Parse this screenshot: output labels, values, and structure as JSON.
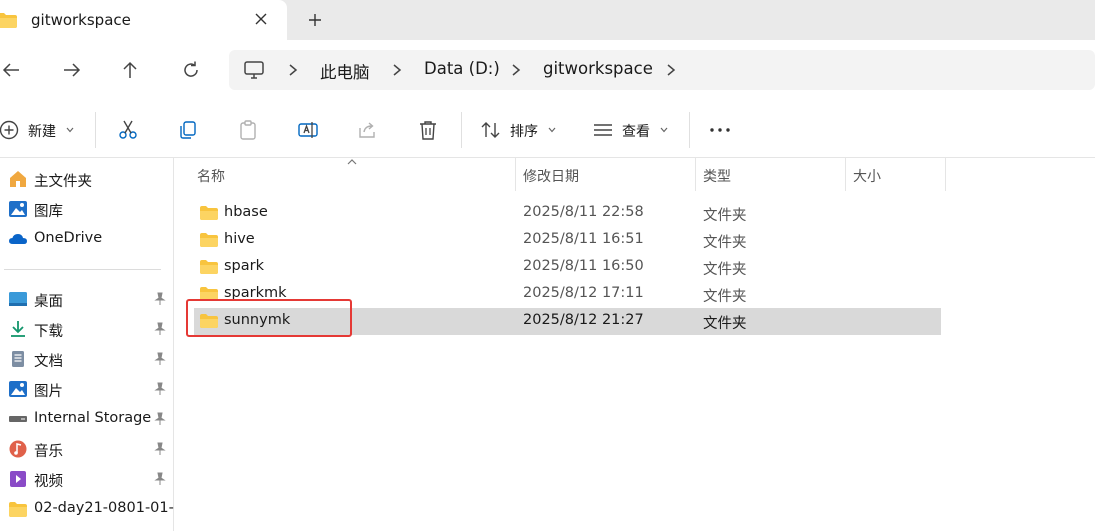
{
  "tab": {
    "title": "gitworkspace"
  },
  "address": {
    "crumbs": [
      "此电脑",
      "Data (D:)",
      "gitworkspace"
    ]
  },
  "toolbar": {
    "new_label": "新建",
    "sort_label": "排序",
    "view_label": "查看"
  },
  "sidebar": {
    "top": [
      {
        "label": "主文件夹",
        "icon": "home-icon"
      },
      {
        "label": "图库",
        "icon": "gallery-icon"
      },
      {
        "label": "OneDrive",
        "icon": "cloud-icon"
      }
    ],
    "pinned": [
      {
        "label": "桌面",
        "icon": "desktop-icon"
      },
      {
        "label": "下载",
        "icon": "download-icon"
      },
      {
        "label": "文档",
        "icon": "document-icon"
      },
      {
        "label": "图片",
        "icon": "pictures-icon"
      },
      {
        "label": "Internal Storage",
        "icon": "drive-icon"
      },
      {
        "label": "音乐",
        "icon": "music-icon"
      },
      {
        "label": "视频",
        "icon": "video-icon"
      },
      {
        "label": "02-day21-0801-01-",
        "icon": "folder-icon"
      }
    ]
  },
  "columns": {
    "name": "名称",
    "modified": "修改日期",
    "type": "类型",
    "size": "大小"
  },
  "files": [
    {
      "name": "hbase",
      "modified": "2025/8/11 22:58",
      "type": "文件夹",
      "selected": false
    },
    {
      "name": "hive",
      "modified": "2025/8/11 16:51",
      "type": "文件夹",
      "selected": false
    },
    {
      "name": "spark",
      "modified": "2025/8/11 16:50",
      "type": "文件夹",
      "selected": false
    },
    {
      "name": "sparkmk",
      "modified": "2025/8/12 17:11",
      "type": "文件夹",
      "selected": false
    },
    {
      "name": "sunnymk",
      "modified": "2025/8/12 21:27",
      "type": "文件夹",
      "selected": true
    }
  ],
  "colors": {
    "accent": "#0067c0",
    "folder": "#f8c43e",
    "highlight": "#e53935",
    "selection": "#d9d9d9"
  }
}
